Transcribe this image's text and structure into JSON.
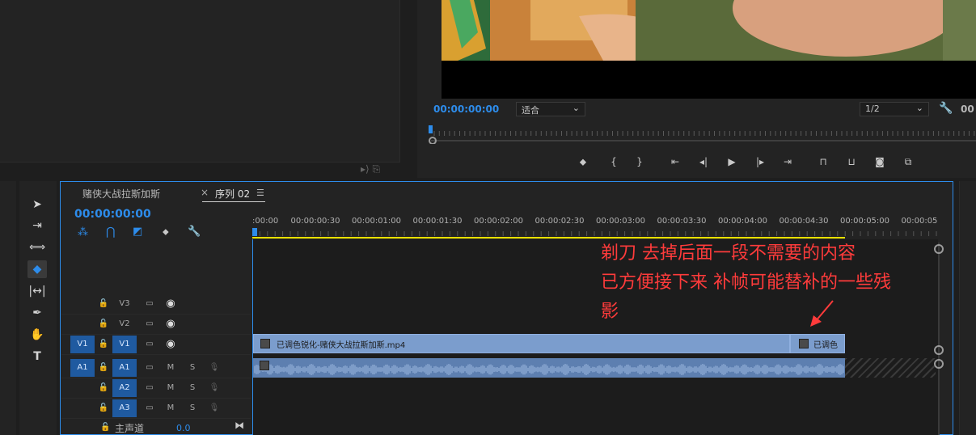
{
  "program_monitor": {
    "timecode": "00:00:00:00",
    "fit_label": "适合",
    "resolution_label": "1/2",
    "timecode_right_partial": "00"
  },
  "timeline": {
    "tabs": [
      {
        "label": "赌侠大战拉斯加斯"
      },
      {
        "label": "序列 02"
      }
    ],
    "close_glyph": "×",
    "menu_glyph": "☰",
    "timecode": "00:00:00:00",
    "ruler_labels": [
      ":00:00",
      "00:00:00:30",
      "00:00:01:00",
      "00:00:01:30",
      "00:00:02:00",
      "00:00:02:30",
      "00:00:03:00",
      "00:00:03:30",
      "00:00:04:00",
      "00:00:04:30",
      "00:00:05:00",
      "00:00:05"
    ],
    "tracks": [
      {
        "name": "V3",
        "src": ""
      },
      {
        "name": "V2",
        "src": ""
      },
      {
        "name": "V1",
        "src": "V1"
      },
      {
        "name": "A1",
        "src": "A1",
        "m": "M",
        "s": "S"
      },
      {
        "name": "A2",
        "src": "",
        "m": "M",
        "s": "S"
      },
      {
        "name": "A3",
        "src": "",
        "m": "M",
        "s": "S"
      }
    ],
    "master": {
      "label": "主声道",
      "value": "0.0"
    },
    "clips": {
      "v1_main": "已调色锐化-赌侠大战拉斯加斯.mp4",
      "v1_second": "已调色"
    }
  },
  "annotation": {
    "lines": [
      "剃刀 去掉后面一段不需要的内容",
      "已方便接下来 补帧可能替补的一些残",
      "影"
    ],
    "color": "#ff3b3b"
  },
  "colors": {
    "accent": "#2d8ceb",
    "video_clip": "#7b9dcd",
    "audio_clip": "#5d7fb0",
    "work_area": "#e8e000"
  }
}
